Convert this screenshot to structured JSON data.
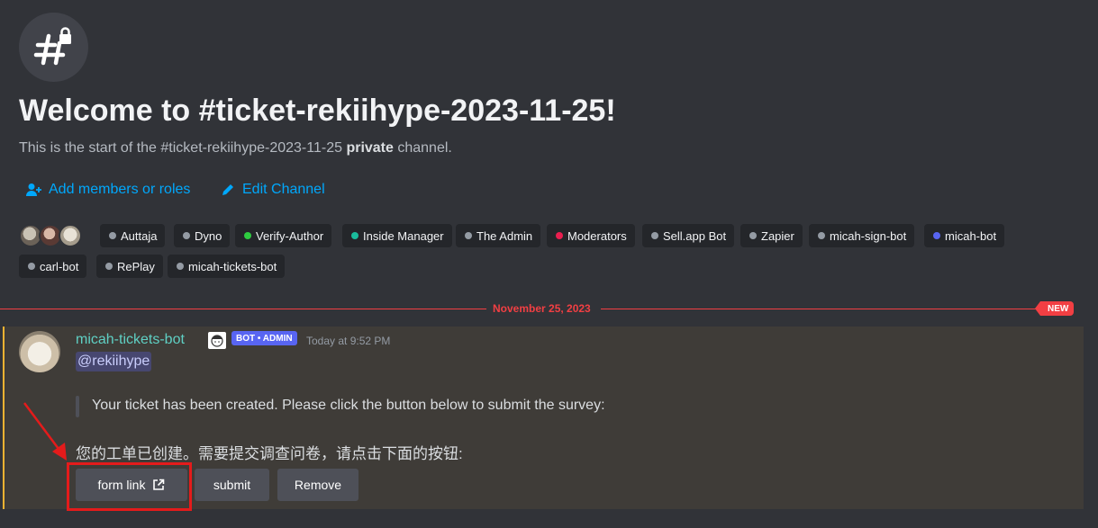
{
  "channel": {
    "icon": "hashtag-lock-icon",
    "title": "Welcome to #ticket-rekiihype-2023-11-25!",
    "start_prefix": "This is the start of the #ticket-rekiihype-2023-11-25 ",
    "start_bold": "private",
    "start_suffix": " channel."
  },
  "actions": {
    "add_members": "Add members or roles",
    "edit_channel": "Edit Channel"
  },
  "roles": [
    {
      "label": "Auttaja",
      "color": "#949ba4"
    },
    {
      "label": "Dyno",
      "color": "#949ba4"
    },
    {
      "label": "Verify-Author",
      "color": "#2ecc40"
    },
    {
      "label": "Inside Manager",
      "color": "#1abc9c"
    },
    {
      "label": "The Admin",
      "color": "#949ba4"
    },
    {
      "label": "Moderators",
      "color": "#e91e4f"
    },
    {
      "label": "Sell.app Bot",
      "color": "#949ba4"
    },
    {
      "label": "Zapier",
      "color": "#949ba4"
    },
    {
      "label": "micah-sign-bot",
      "color": "#949ba4"
    },
    {
      "label": "micah-bot",
      "color": "#5865f2"
    },
    {
      "label": "carl-bot",
      "color": "#949ba4"
    },
    {
      "label": "RePlay",
      "color": "#949ba4"
    },
    {
      "label": "micah-tickets-bot",
      "color": "#949ba4"
    }
  ],
  "divider": {
    "date": "November 25, 2023",
    "badge": "NEW"
  },
  "message": {
    "username": "micah-tickets-bot",
    "bot_badge": "BOT • ADMIN",
    "timestamp": "Today at 9:52 PM",
    "mention": "@rekiihype",
    "quote": "Your ticket has been created. Please click the button below to submit the survey:",
    "chinese": "您的工单已创建。需要提交调查问卷，请点击下面的按钮:",
    "buttons": {
      "form_link": "form link",
      "submit": "submit",
      "remove": "Remove"
    }
  },
  "colors": {
    "link": "#00a8fc",
    "highlight": "#e41b1b",
    "new_divider": "#f23f43",
    "bot_badge": "#5865f2"
  }
}
